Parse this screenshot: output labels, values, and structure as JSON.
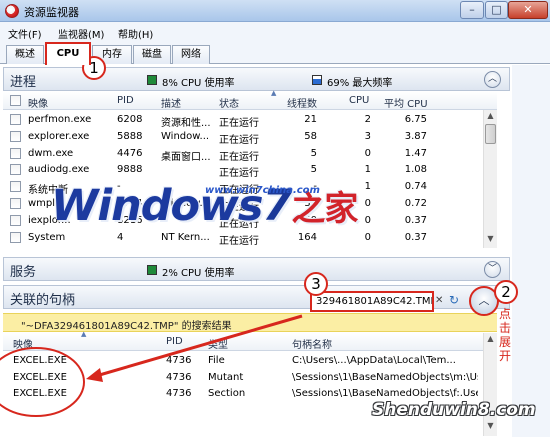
{
  "window": {
    "title": "资源监视器",
    "controls": [
      "–",
      "□",
      "✕"
    ]
  },
  "menu": [
    "文件(F)",
    "监视器(M)",
    "帮助(H)"
  ],
  "tabs": [
    "概述",
    "CPU",
    "内存",
    "磁盘",
    "网络"
  ],
  "processes": {
    "title": "进程",
    "cpu_usage": "8% CPU 使用率",
    "max_freq": "69% 最大频率",
    "columns": [
      "映像",
      "PID",
      "描述",
      "状态",
      "线程数",
      "CPU",
      "平均 CPU"
    ],
    "rows": [
      [
        "perfmon.exe",
        "6208",
        "资源和性...",
        "正在运行",
        "21",
        "2",
        "6.75"
      ],
      [
        "explorer.exe",
        "5888",
        "Window...",
        "正在运行",
        "58",
        "3",
        "3.87"
      ],
      [
        "dwm.exe",
        "4476",
        "桌面窗口...",
        "正在运行",
        "5",
        "0",
        "1.47"
      ],
      [
        "audiodg.exe",
        "9888",
        "",
        "正在运行",
        "5",
        "1",
        "1.08"
      ],
      [
        "系统中断",
        "-",
        "",
        "正在运行",
        "-",
        "1",
        "0.74"
      ],
      [
        "wmpl...",
        "6704",
        "Window...",
        "正在运行",
        "33",
        "0",
        "0.72"
      ],
      [
        "iexplor...",
        "8216",
        "",
        "正在运行",
        "50",
        "0",
        "0.37"
      ],
      [
        "System",
        "4",
        "NT Kern...",
        "正在运行",
        "164",
        "0",
        "0.37"
      ]
    ]
  },
  "services": {
    "title": "服务",
    "cpu_usage": "2% CPU 使用率"
  },
  "handles": {
    "title": "关联的句柄",
    "search_value": "329461801A89C42.TMP",
    "clear_glyph": "✕",
    "banner": "\"~DFA329461801A89C42.TMP\" 的搜索结果",
    "columns": [
      "映像",
      "PID",
      "类型",
      "句柄名称"
    ],
    "rows": [
      [
        "EXCEL.EXE",
        "4736",
        "File",
        "C:\\Users\\...\\AppData\\Local\\Tem..."
      ],
      [
        "EXCEL.EXE",
        "4736",
        "Mutant",
        "\\Sessions\\1\\BaseNamedObjects\\m:\\Us..."
      ],
      [
        "EXCEL.EXE",
        "4736",
        "Section",
        "\\Sessions\\1\\BaseNamedObjects\\f:.User..."
      ]
    ]
  },
  "annotations": {
    "callout_1": "1",
    "callout_2": "2",
    "callout_3": "3",
    "side_note": "点击展开"
  },
  "watermark": {
    "brand_windows": "Windows",
    "brand_seven": "7",
    "brand_zh": "之家",
    "url": "www.win7china.com",
    "shendu": "Shenduwin8.com"
  },
  "colors": {
    "accent_red": "#d7271d",
    "cpu_usage_green": "#1f8a3a",
    "max_freq_blue": "#2a6bd1",
    "banner_yellow": "#fbeea4"
  },
  "icons": {
    "app": "resource-monitor-icon",
    "expand": "chevron-up-icon",
    "refresh": "refresh-icon",
    "clear": "close-icon"
  }
}
